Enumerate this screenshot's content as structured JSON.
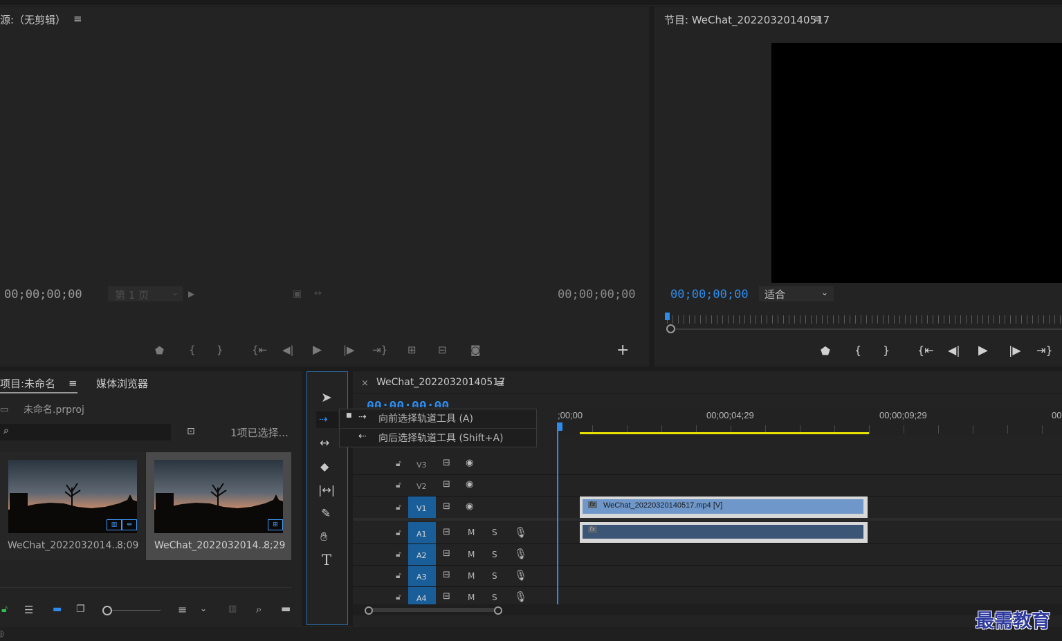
{
  "source_panel": {
    "title": "源:（无剪辑）",
    "menu_icon": "≡",
    "timecode_left": "00;00;00;00",
    "page_label": "第 1 页",
    "timecode_right": "00;00;00;00",
    "add_button": "+"
  },
  "program_panel": {
    "title": "节目: WeChat_20220320140517",
    "menu_icon": "≡",
    "timecode": "00;00;00;00",
    "fit_label": "适合"
  },
  "project_panel": {
    "tab_project": "项目:未命名",
    "tab_menu_icon": "≡",
    "tab_media_browser": "媒体浏览器",
    "project_file": "未命名.prproj",
    "selection_status": "1项已选择...",
    "search_placeholder": "",
    "items": [
      {
        "name": "WeChat_2022032014...",
        "duration": "8;09"
      },
      {
        "name": "WeChat_2022032014...",
        "duration": "8;29"
      }
    ]
  },
  "tool_menu": {
    "items": [
      {
        "label": "向前选择轨道工具 (A)",
        "selected": true
      },
      {
        "label": "向后选择轨道工具 (Shift+A)",
        "selected": false
      }
    ]
  },
  "timeline": {
    "close": "×",
    "sequence_name": "WeChat_20220320140517",
    "menu_icon": "≡",
    "timecode": "00;00;00;00",
    "ruler_labels": [
      ";00;00",
      "00;00;04;29",
      "00;00;09;29",
      "00"
    ],
    "video_tracks": [
      {
        "name": "V3",
        "targeted": false
      },
      {
        "name": "V2",
        "targeted": false
      },
      {
        "name": "V1",
        "targeted": true
      }
    ],
    "audio_tracks": [
      {
        "name": "A1",
        "mute": "M",
        "solo": "S"
      },
      {
        "name": "A2",
        "mute": "M",
        "solo": "S"
      },
      {
        "name": "A3",
        "mute": "M",
        "solo": "S"
      },
      {
        "name": "A4",
        "mute": "M",
        "solo": "S"
      }
    ],
    "video_clip_label": "WeChat_20220320140517.mp4 [V]",
    "fx_badge": "fx"
  },
  "watermark": "最需教育",
  "colors": {
    "accent_blue": "#2d8ceb",
    "video_clip": "#6f97c9",
    "audio_clip": "#3a5576",
    "work_area": "#e8e000",
    "track_target": "#1a5e99"
  }
}
